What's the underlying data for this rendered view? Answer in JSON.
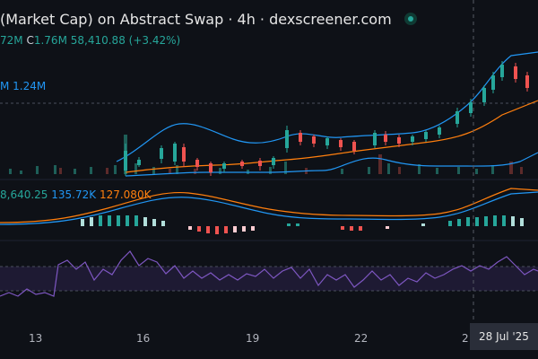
{
  "header": {
    "title": "(Market Cap) on Abstract Swap · 4h · dexscreener.com",
    "ohlc_prefix": "72M",
    "close_key": "C",
    "close_value": "1.76M",
    "change": "58,410.88 (+3.42%)"
  },
  "ma_legend": "M 1.24M",
  "macd_legend": {
    "v1": "8,640.25",
    "v2": "135.72K",
    "v3": "127.080K"
  },
  "x_axis": {
    "ticks": [
      "13",
      "16",
      "19",
      "22",
      "2"
    ],
    "crosshair_label": "28 Jul '25"
  },
  "colors": {
    "up": "#26a69a",
    "down": "#ef5350",
    "bollinger": "#2196f3",
    "ma": "#ff7f0e",
    "rsi": "#7e57c2",
    "background": "#0e1117"
  }
}
